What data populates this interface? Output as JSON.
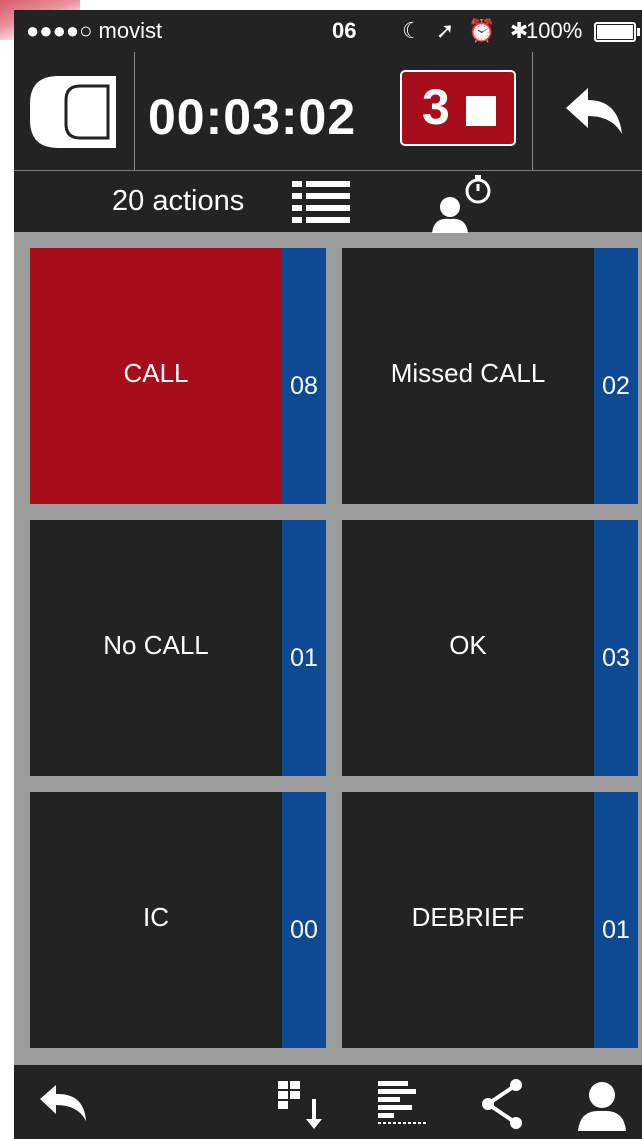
{
  "status_bar": {
    "carrier": "●●●●○ movist",
    "time": "06",
    "icons": "☾ ➚ ⏰ ✱",
    "battery_percent": "100%"
  },
  "header": {
    "logo_icon": "app-logo-icon",
    "timer": "00:03:02",
    "stop_count": "3",
    "stop_icon": "stop-square-icon",
    "back_icon": "back-arrow-icon"
  },
  "toolbar": {
    "actions_label": "20 actions",
    "list_icon": "list-icon",
    "user_timer_icon": "user-stopwatch-icon"
  },
  "tiles": [
    {
      "label": "CALL",
      "count": "08",
      "active": true
    },
    {
      "label": "Missed CALL",
      "count": "02",
      "active": false
    },
    {
      "label": "No CALL",
      "count": "01",
      "active": false
    },
    {
      "label": "OK",
      "count": "03",
      "active": false
    },
    {
      "label": "IC",
      "count": "00",
      "active": false
    },
    {
      "label": "DEBRIEF",
      "count": "01",
      "active": false
    }
  ],
  "bottom_bar": {
    "icons": [
      "undo-icon",
      "grid-sort-icon",
      "bar-list-icon",
      "share-icon",
      "user-icon"
    ]
  },
  "colors": {
    "background": "#9b9b9b",
    "bar": "#232323",
    "active_tile": "#a80d1b",
    "counter": "#0d4a93"
  }
}
